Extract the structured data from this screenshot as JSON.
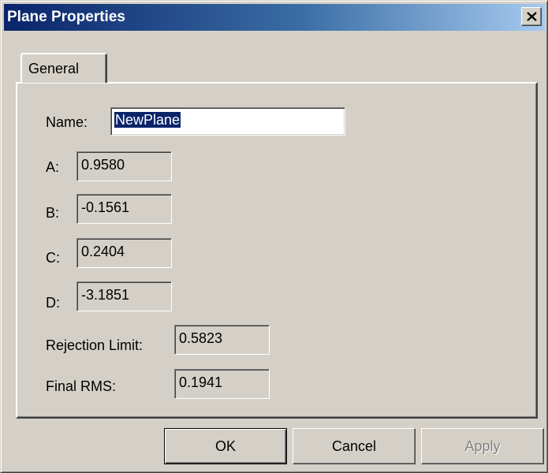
{
  "window": {
    "title": "Plane Properties"
  },
  "tabs": [
    {
      "label": "General",
      "selected": true
    }
  ],
  "fields": {
    "name": {
      "label": "Name:",
      "value": "NewPlane",
      "selected_text": true
    },
    "a": {
      "label": "A:",
      "value": "0.9580"
    },
    "b": {
      "label": "B:",
      "value": "-0.1561"
    },
    "c": {
      "label": "C:",
      "value": "0.2404"
    },
    "d": {
      "label": "D:",
      "value": "-3.1851"
    },
    "rejection_limit": {
      "label": "Rejection Limit:",
      "value": "0.5823"
    },
    "final_rms": {
      "label": "Final RMS:",
      "value": "0.1941"
    }
  },
  "buttons": {
    "ok": {
      "label": "OK",
      "default": true
    },
    "cancel": {
      "label": "Cancel"
    },
    "apply": {
      "label": "Apply",
      "enabled": false
    }
  },
  "icons": {
    "close": "close-icon"
  },
  "colors": {
    "title_gradient_start": "#0a246a",
    "title_gradient_end": "#a6caf0",
    "face": "#d4d0c8",
    "selection": "#0a246a"
  }
}
